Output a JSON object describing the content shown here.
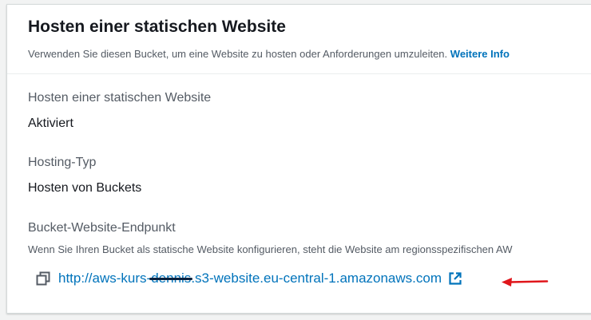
{
  "section": {
    "title": "Hosten einer statischen Website",
    "description": "Verwenden Sie diesen Bucket, um eine Website zu hosten oder Anforderungen umzuleiten.",
    "more_info_link": "Weitere Info"
  },
  "fields": {
    "hosting": {
      "label": "Hosten einer statischen Website",
      "value": "Aktiviert"
    },
    "hosting_type": {
      "label": "Hosting-Typ",
      "value": "Hosten von Buckets"
    },
    "endpoint": {
      "label": "Bucket-Website-Endpunkt",
      "hint": "Wenn Sie Ihren Bucket als statische Website konfigurieren, steht die Website am regionsspezifischen AW",
      "url_prefix": "http://aws-kurs-",
      "url_redacted": "dennis",
      "url_suffix": ".s3-website.eu-central-1.amazonaws.com"
    }
  },
  "icons": {
    "copy": "copy-icon",
    "external_link": "external-link-icon",
    "annotation_arrow": "red-arrow-annotation"
  },
  "colors": {
    "link": "#0073bb",
    "annotation": "#e0161b",
    "heading": "#16191f",
    "secondary_text": "#545b64"
  }
}
